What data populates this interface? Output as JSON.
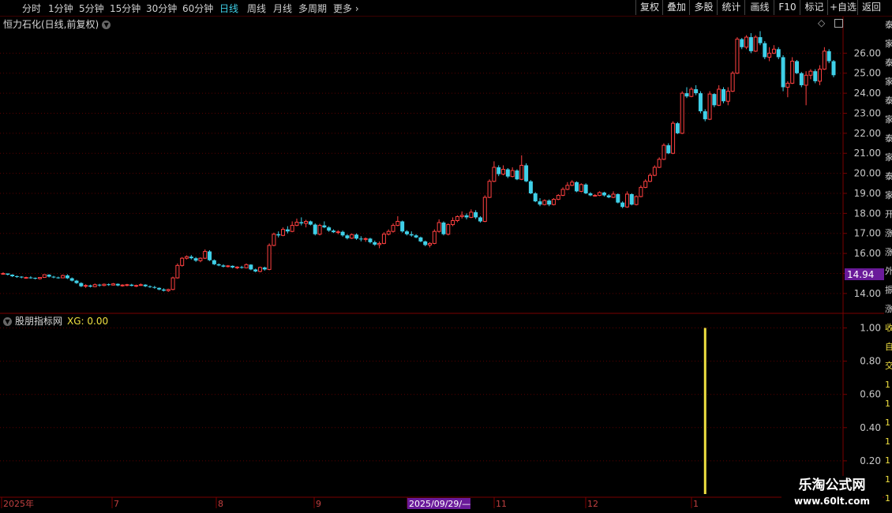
{
  "toolbar": {
    "periods": [
      {
        "label": "分时",
        "active": false
      },
      {
        "label": "1分钟",
        "active": false
      },
      {
        "label": "5分钟",
        "active": false
      },
      {
        "label": "15分钟",
        "active": false
      },
      {
        "label": "30分钟",
        "active": false
      },
      {
        "label": "60分钟",
        "active": false
      },
      {
        "label": "日线",
        "active": true
      },
      {
        "label": "周线",
        "active": false
      },
      {
        "label": "月线",
        "active": false
      },
      {
        "label": "多周期",
        "active": false
      },
      {
        "label": "更多",
        "active": false
      }
    ],
    "buttons": [
      "复权",
      "叠加",
      "多股",
      "统计",
      "画线",
      "F10",
      "标记",
      "+自选",
      "返回"
    ]
  },
  "chart_header": {
    "title": "恒力石化(日线,前复权)",
    "circle_icon": "chevron-down-icon",
    "right_icons": [
      "diamond-icon",
      "window-icon"
    ]
  },
  "indicator_header": {
    "name": "股朋指标网",
    "xg_label": "XG: 0.00",
    "circle_icon": "chevron-down-icon"
  },
  "colors": {
    "up": "#ff4040",
    "down": "#3fd0e8",
    "grid": "#5a0000",
    "axis_text": "#c8c8c8",
    "signal": "#f0e040",
    "price_badge": "#6a1a9a",
    "date_badge": "#6a1a9a"
  },
  "price_axis": {
    "ticks": [
      "26.00",
      "25.00",
      "24.00",
      "23.00",
      "22.00",
      "21.00",
      "20.00",
      "19.00",
      "18.00",
      "17.00",
      "16.00",
      "15.00",
      "14.00"
    ],
    "current_price": "14.94"
  },
  "indicator_axis": {
    "ticks": [
      "1.00",
      "0.80",
      "0.60",
      "0.40",
      "0.20"
    ]
  },
  "date_axis": {
    "labels": [
      "2025年",
      "7",
      "8",
      "9",
      "2025/09/29/—",
      "11",
      "12",
      "1"
    ]
  },
  "right_strip": {
    "chars": [
      "泰",
      "家",
      "泰",
      "家",
      "泰",
      "家",
      "泰",
      "家",
      "泰",
      "家",
      "开",
      "涨",
      "涨",
      "外",
      "振",
      "涨",
      "收",
      "自",
      "交",
      "1",
      "1",
      "1",
      "1",
      "1",
      "1",
      "1",
      "1"
    ]
  },
  "watermark": {
    "title": "乐淘公式网",
    "url": "www.60lt.com"
  },
  "chart_data": {
    "type": "candlestick",
    "y_range": [
      13.6,
      27.0
    ],
    "indicator": {
      "name": "XG",
      "y_range": [
        0,
        1.05
      ],
      "signal_index": 153,
      "signal_value": 1.0
    },
    "candles": [
      [
        15.0,
        15.06,
        14.94,
        15.0
      ],
      [
        15.0,
        15.0,
        14.9,
        14.94
      ],
      [
        14.94,
        14.96,
        14.82,
        14.86
      ],
      [
        14.86,
        14.9,
        14.78,
        14.84
      ],
      [
        14.84,
        14.86,
        14.76,
        14.8
      ],
      [
        14.8,
        14.84,
        14.74,
        14.8
      ],
      [
        14.8,
        14.86,
        14.74,
        14.78
      ],
      [
        14.78,
        14.8,
        14.7,
        14.74
      ],
      [
        14.74,
        14.82,
        14.7,
        14.8
      ],
      [
        14.8,
        14.96,
        14.78,
        14.94
      ],
      [
        14.94,
        14.96,
        14.8,
        14.84
      ],
      [
        14.84,
        14.88,
        14.76,
        14.8
      ],
      [
        14.8,
        14.84,
        14.74,
        14.78
      ],
      [
        14.78,
        14.94,
        14.76,
        14.9
      ],
      [
        14.9,
        14.96,
        14.72,
        14.76
      ],
      [
        14.76,
        14.8,
        14.6,
        14.64
      ],
      [
        14.64,
        14.68,
        14.48,
        14.52
      ],
      [
        14.52,
        14.56,
        14.32,
        14.36
      ],
      [
        14.36,
        14.46,
        14.28,
        14.4
      ],
      [
        14.4,
        14.44,
        14.3,
        14.34
      ],
      [
        14.34,
        14.5,
        14.32,
        14.44
      ],
      [
        14.44,
        14.48,
        14.34,
        14.4
      ],
      [
        14.4,
        14.5,
        14.36,
        14.46
      ],
      [
        14.46,
        14.5,
        14.38,
        14.42
      ],
      [
        14.42,
        14.52,
        14.4,
        14.48
      ],
      [
        14.48,
        14.5,
        14.36,
        14.4
      ],
      [
        14.4,
        14.46,
        14.34,
        14.42
      ],
      [
        14.42,
        14.48,
        14.36,
        14.44
      ],
      [
        14.44,
        14.48,
        14.36,
        14.38
      ],
      [
        14.38,
        14.44,
        14.32,
        14.4
      ],
      [
        14.4,
        14.5,
        14.38,
        14.44
      ],
      [
        14.44,
        14.46,
        14.32,
        14.36
      ],
      [
        14.36,
        14.4,
        14.28,
        14.32
      ],
      [
        14.32,
        14.38,
        14.24,
        14.28
      ],
      [
        14.28,
        14.3,
        14.16,
        14.2
      ],
      [
        14.2,
        14.26,
        14.1,
        14.14
      ],
      [
        14.14,
        14.24,
        14.08,
        14.2
      ],
      [
        14.2,
        14.84,
        14.16,
        14.78
      ],
      [
        14.78,
        15.5,
        14.74,
        15.4
      ],
      [
        15.4,
        15.82,
        15.34,
        15.76
      ],
      [
        15.76,
        15.9,
        15.7,
        15.84
      ],
      [
        15.84,
        15.92,
        15.7,
        15.76
      ],
      [
        15.76,
        15.82,
        15.58,
        15.64
      ],
      [
        15.64,
        15.8,
        15.56,
        15.76
      ],
      [
        15.76,
        16.2,
        15.72,
        16.1
      ],
      [
        16.1,
        16.16,
        15.62,
        15.66
      ],
      [
        15.66,
        15.7,
        15.42,
        15.46
      ],
      [
        15.46,
        15.5,
        15.36,
        15.4
      ],
      [
        15.4,
        15.46,
        15.3,
        15.34
      ],
      [
        15.34,
        15.42,
        15.3,
        15.38
      ],
      [
        15.38,
        15.4,
        15.26,
        15.3
      ],
      [
        15.3,
        15.36,
        15.22,
        15.32
      ],
      [
        15.32,
        15.38,
        15.24,
        15.28
      ],
      [
        15.28,
        15.5,
        15.26,
        15.44
      ],
      [
        15.44,
        15.46,
        15.16,
        15.2
      ],
      [
        15.2,
        15.24,
        15.06,
        15.1
      ],
      [
        15.1,
        15.34,
        15.06,
        15.3
      ],
      [
        15.3,
        15.34,
        15.14,
        15.2
      ],
      [
        15.2,
        16.5,
        15.16,
        16.4
      ],
      [
        16.4,
        17.04,
        16.36,
        16.96
      ],
      [
        16.96,
        17.1,
        16.8,
        16.9
      ],
      [
        16.9,
        17.3,
        16.86,
        17.2
      ],
      [
        17.2,
        17.36,
        17.0,
        17.1
      ],
      [
        17.1,
        17.6,
        17.06,
        17.4
      ],
      [
        17.4,
        17.74,
        17.36,
        17.56
      ],
      [
        17.56,
        17.8,
        17.4,
        17.5
      ],
      [
        17.5,
        17.68,
        17.3,
        17.6
      ],
      [
        17.6,
        17.64,
        17.4,
        17.44
      ],
      [
        17.44,
        17.5,
        16.9,
        16.96
      ],
      [
        16.96,
        17.48,
        16.9,
        17.4
      ],
      [
        17.4,
        17.6,
        17.26,
        17.3
      ],
      [
        17.3,
        17.36,
        17.08,
        17.14
      ],
      [
        17.14,
        17.2,
        17.02,
        17.06
      ],
      [
        17.06,
        17.16,
        16.96,
        17.08
      ],
      [
        17.08,
        17.14,
        16.84,
        16.9
      ],
      [
        16.9,
        16.96,
        16.7,
        16.76
      ],
      [
        16.76,
        17.0,
        16.72,
        16.94
      ],
      [
        16.94,
        17.0,
        16.68,
        16.74
      ],
      [
        16.74,
        16.86,
        16.6,
        16.7
      ],
      [
        16.7,
        16.8,
        16.58,
        16.74
      ],
      [
        16.74,
        16.78,
        16.5,
        16.56
      ],
      [
        16.56,
        16.64,
        16.38,
        16.44
      ],
      [
        16.44,
        16.6,
        16.26,
        16.5
      ],
      [
        16.5,
        17.06,
        16.46,
        16.96
      ],
      [
        16.96,
        17.2,
        16.9,
        17.1
      ],
      [
        17.1,
        17.5,
        17.04,
        17.4
      ],
      [
        17.4,
        17.86,
        17.36,
        17.6
      ],
      [
        17.6,
        17.64,
        17.04,
        17.1
      ],
      [
        17.1,
        17.16,
        16.9,
        16.96
      ],
      [
        16.96,
        17.1,
        16.84,
        16.9
      ],
      [
        16.9,
        16.96,
        16.76,
        16.8
      ],
      [
        16.8,
        16.84,
        16.56,
        16.6
      ],
      [
        16.6,
        16.64,
        16.36,
        16.42
      ],
      [
        16.42,
        16.56,
        16.3,
        16.5
      ],
      [
        16.5,
        17.2,
        16.46,
        17.1
      ],
      [
        17.1,
        17.7,
        17.04,
        17.54
      ],
      [
        17.54,
        17.6,
        16.9,
        16.96
      ],
      [
        16.96,
        17.5,
        16.9,
        17.44
      ],
      [
        17.44,
        17.8,
        17.36,
        17.64
      ],
      [
        17.64,
        17.9,
        17.56,
        17.84
      ],
      [
        17.84,
        18.1,
        17.74,
        17.9
      ],
      [
        17.9,
        18.0,
        17.7,
        17.8
      ],
      [
        17.8,
        18.2,
        17.76,
        18.06
      ],
      [
        18.06,
        18.16,
        17.72,
        17.8
      ],
      [
        17.8,
        17.86,
        17.54,
        17.6
      ],
      [
        17.6,
        18.9,
        17.56,
        18.8
      ],
      [
        18.8,
        19.7,
        18.76,
        19.6
      ],
      [
        19.6,
        20.6,
        19.56,
        20.3
      ],
      [
        20.3,
        20.4,
        19.86,
        19.96
      ],
      [
        19.96,
        20.4,
        19.9,
        20.2
      ],
      [
        20.2,
        20.26,
        19.76,
        19.84
      ],
      [
        19.84,
        20.3,
        19.8,
        20.14
      ],
      [
        20.14,
        20.2,
        19.66,
        19.7
      ],
      [
        19.7,
        20.9,
        19.66,
        20.4
      ],
      [
        20.4,
        20.5,
        19.56,
        19.6
      ],
      [
        19.6,
        19.66,
        18.96,
        19.0
      ],
      [
        19.0,
        19.06,
        18.56,
        18.6
      ],
      [
        18.6,
        18.76,
        18.36,
        18.44
      ],
      [
        18.44,
        18.7,
        18.4,
        18.64
      ],
      [
        18.64,
        18.7,
        18.36,
        18.44
      ],
      [
        18.44,
        18.76,
        18.4,
        18.7
      ],
      [
        18.7,
        18.96,
        18.66,
        18.9
      ],
      [
        18.9,
        19.3,
        18.86,
        19.2
      ],
      [
        19.2,
        19.56,
        19.16,
        19.4
      ],
      [
        19.4,
        19.66,
        19.36,
        19.56
      ],
      [
        19.56,
        19.6,
        19.06,
        19.1
      ],
      [
        19.1,
        19.5,
        19.06,
        19.44
      ],
      [
        19.44,
        19.5,
        18.96,
        19.0
      ],
      [
        19.0,
        19.06,
        18.86,
        18.9
      ],
      [
        18.9,
        18.96,
        18.86,
        18.9
      ],
      [
        18.9,
        19.1,
        18.86,
        19.04
      ],
      [
        19.04,
        19.08,
        18.84,
        18.9
      ],
      [
        18.9,
        18.96,
        18.76,
        18.8
      ],
      [
        18.8,
        19.1,
        18.76,
        18.96
      ],
      [
        18.96,
        19.0,
        18.5,
        18.54
      ],
      [
        18.54,
        18.6,
        18.26,
        18.32
      ],
      [
        18.32,
        19.1,
        18.28,
        18.96
      ],
      [
        18.96,
        19.0,
        18.4,
        18.44
      ],
      [
        18.44,
        18.9,
        18.4,
        18.84
      ],
      [
        18.84,
        19.4,
        18.8,
        19.3
      ],
      [
        19.3,
        19.7,
        19.26,
        19.6
      ],
      [
        19.6,
        20.0,
        19.56,
        19.9
      ],
      [
        19.9,
        20.4,
        19.86,
        20.3
      ],
      [
        20.3,
        20.8,
        20.26,
        20.7
      ],
      [
        20.7,
        21.5,
        20.66,
        21.4
      ],
      [
        21.4,
        21.5,
        20.96,
        21.0
      ],
      [
        21.0,
        22.6,
        20.96,
        22.5
      ],
      [
        22.5,
        22.56,
        21.96,
        22.0
      ],
      [
        22.0,
        24.1,
        21.96,
        24.0
      ],
      [
        24.0,
        24.3,
        23.76,
        23.84
      ],
      [
        23.84,
        24.3,
        23.8,
        24.2
      ],
      [
        24.2,
        24.4,
        23.9,
        24.0
      ],
      [
        24.0,
        24.1,
        23.0,
        23.1
      ],
      [
        23.1,
        23.2,
        22.6,
        22.7
      ],
      [
        22.7,
        24.1,
        22.66,
        23.96
      ],
      [
        23.96,
        24.0,
        23.3,
        23.4
      ],
      [
        23.4,
        24.4,
        23.36,
        24.2
      ],
      [
        24.2,
        24.3,
        23.5,
        23.6
      ],
      [
        23.6,
        24.3,
        23.4,
        24.1
      ],
      [
        24.1,
        25.1,
        24.06,
        25.0
      ],
      [
        25.0,
        26.8,
        24.96,
        26.7
      ],
      [
        26.7,
        26.76,
        26.2,
        26.3
      ],
      [
        26.3,
        26.9,
        26.2,
        26.8
      ],
      [
        26.8,
        27.0,
        26.0,
        26.1
      ],
      [
        26.1,
        26.9,
        26.06,
        26.8
      ],
      [
        26.8,
        27.1,
        26.4,
        26.5
      ],
      [
        26.5,
        26.6,
        25.7,
        25.8
      ],
      [
        25.8,
        26.3,
        25.6,
        26.0
      ],
      [
        26.0,
        26.4,
        25.96,
        26.2
      ],
      [
        26.2,
        26.3,
        25.7,
        25.8
      ],
      [
        25.8,
        25.9,
        24.1,
        24.3
      ],
      [
        24.3,
        24.6,
        23.8,
        24.5
      ],
      [
        24.5,
        25.8,
        24.46,
        25.6
      ],
      [
        25.6,
        25.66,
        24.96,
        25.0
      ],
      [
        25.0,
        25.06,
        24.3,
        24.4
      ],
      [
        24.4,
        25.1,
        23.4,
        24.9
      ],
      [
        24.9,
        25.2,
        24.7,
        25.1
      ],
      [
        25.1,
        25.2,
        24.5,
        24.6
      ],
      [
        24.6,
        25.4,
        24.4,
        25.2
      ],
      [
        25.2,
        26.3,
        25.16,
        26.1
      ],
      [
        26.1,
        26.2,
        25.5,
        25.6
      ],
      [
        25.6,
        25.66,
        24.8,
        24.9
      ]
    ]
  }
}
